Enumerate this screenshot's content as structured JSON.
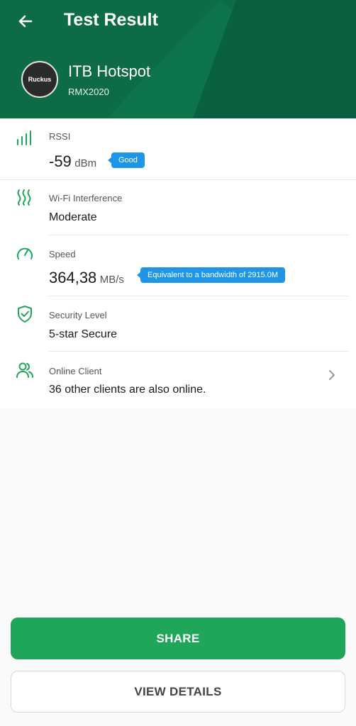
{
  "header": {
    "title": "Test Result",
    "back_icon": "arrow-left-icon",
    "network": {
      "avatar_text": "Ruckus",
      "ssid": "ITB Hotspot",
      "model": "RMX2020"
    }
  },
  "rows": {
    "rssi": {
      "label": "RSSI",
      "value": "-59",
      "unit": "dBm",
      "badge": "Good",
      "icon": "signal-bars-icon"
    },
    "interference": {
      "label": "Wi-Fi Interference",
      "value": "Moderate",
      "icon": "waves-icon"
    },
    "speed": {
      "label": "Speed",
      "value": "364,38",
      "unit": "MB/s",
      "badge": "Equivalent to a bandwidth of 2915.0M",
      "icon": "speedometer-icon"
    },
    "security": {
      "label": "Security Level",
      "value": "5-star Secure",
      "icon": "shield-check-icon"
    },
    "clients": {
      "label": "Online Client",
      "value": "36 other clients are also online.",
      "icon": "users-icon"
    }
  },
  "buttons": {
    "share": "SHARE",
    "view_details": "VIEW DETAILS"
  },
  "colors": {
    "header_bg": "#0d6b46",
    "accent_green": "#1fa65a",
    "badge_blue": "#1e95e6"
  }
}
